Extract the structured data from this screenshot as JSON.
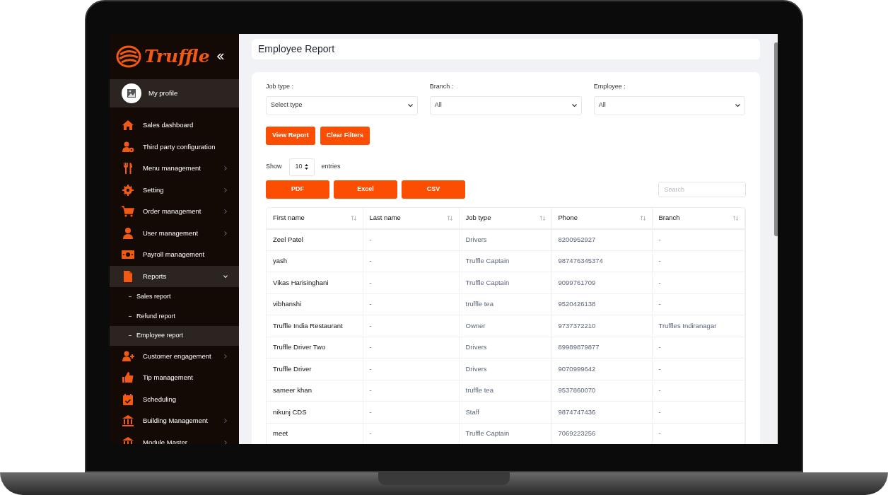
{
  "brand": "Truffle",
  "profile": {
    "label": "My profile"
  },
  "sidebar": {
    "items": [
      {
        "label": "Sales dashboard",
        "kind": "link",
        "selected": false
      },
      {
        "label": "Third party configuration",
        "kind": "link",
        "selected": false
      },
      {
        "label": "Menu management",
        "kind": "menu",
        "expanded": false,
        "selected": false
      },
      {
        "label": "Setting",
        "kind": "menu",
        "expanded": false,
        "selected": false
      },
      {
        "label": "Order management",
        "kind": "menu",
        "expanded": false,
        "selected": false
      },
      {
        "label": "User management",
        "kind": "menu",
        "expanded": false,
        "selected": false
      },
      {
        "label": "Payroll management",
        "kind": "link",
        "selected": false
      },
      {
        "label": "Reports",
        "kind": "menu",
        "expanded": true,
        "selected": true,
        "children": [
          {
            "label": "Sales report",
            "selected": false
          },
          {
            "label": "Refund report",
            "selected": false
          },
          {
            "label": "Employee report",
            "selected": true
          }
        ]
      },
      {
        "label": "Customer engagement",
        "kind": "menu",
        "expanded": false,
        "selected": false
      },
      {
        "label": "Tip management",
        "kind": "link",
        "selected": false
      },
      {
        "label": "Scheduling",
        "kind": "link",
        "selected": false
      },
      {
        "label": "Building Management",
        "kind": "menu",
        "expanded": false,
        "selected": false
      },
      {
        "label": "Module Master",
        "kind": "menu",
        "expanded": false,
        "selected": false
      }
    ]
  },
  "page_title": "Employee Report",
  "filters": [
    {
      "label": "Job type :",
      "value": "Select type"
    },
    {
      "label": "Branch :",
      "value": "All"
    },
    {
      "label": "Employee :",
      "value": "All"
    }
  ],
  "actions": [
    "View Report",
    "Clear Filters"
  ],
  "entries": {
    "show": "Show",
    "value": "10",
    "suffix": "entries"
  },
  "exports": [
    "PDF",
    "Excel",
    "CSV"
  ],
  "search": {
    "placeholder": "Search"
  },
  "table": {
    "columns": [
      "First name",
      "Last name",
      "Job type",
      "Phone",
      "Branch"
    ],
    "rows": [
      [
        "Zeel Patel",
        "-",
        "Drivers",
        "8200952927",
        "-"
      ],
      [
        "yash",
        "-",
        "Truffle Captain",
        "987476345374",
        "-"
      ],
      [
        "Vikas Harisinghani",
        "-",
        "Truffle Captain",
        "9099761709",
        "-"
      ],
      [
        "vibhanshi",
        "-",
        "truffle tea",
        "9520426138",
        "-"
      ],
      [
        "Truffle India Restaurant",
        "-",
        "Owner",
        "9737372210",
        "Truffles Indiranagar"
      ],
      [
        "Truffle Driver Two",
        "-",
        "Drivers",
        "89989879877",
        "-"
      ],
      [
        "Truffle Driver",
        "-",
        "Drivers",
        "9070999642",
        "-"
      ],
      [
        "sameer khan",
        "-",
        "truffle tea",
        "9537860070",
        "-"
      ],
      [
        "nikunj CDS",
        "-",
        "Staff",
        "9874747436",
        "-"
      ],
      [
        "meet",
        "-",
        "Truffle Captain",
        "7069223256",
        "-"
      ]
    ]
  }
}
